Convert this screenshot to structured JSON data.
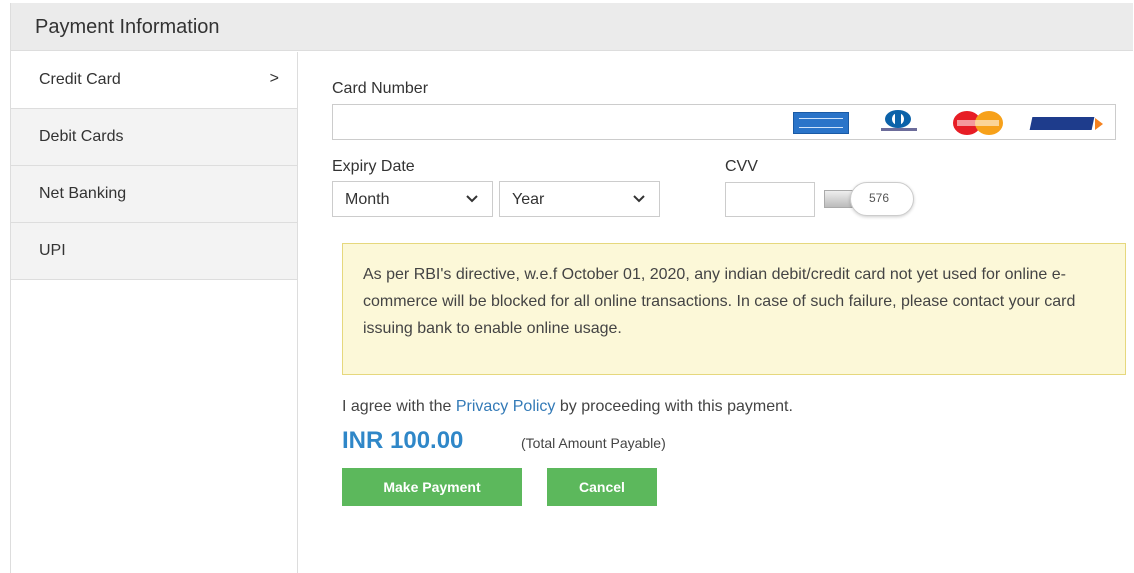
{
  "panel": {
    "title": "Payment Information"
  },
  "sidebar": {
    "items": [
      {
        "label": "Credit Card",
        "chevron": ">",
        "active": true
      },
      {
        "label": "Debit Cards"
      },
      {
        "label": "Net Banking"
      },
      {
        "label": "UPI"
      }
    ]
  },
  "form": {
    "card_number_label": "Card Number",
    "card_number_value": "",
    "card_logos": [
      "american-express",
      "diners-club",
      "mastercard",
      "rupay"
    ],
    "expiry_label": "Expiry Date",
    "month_selected": "Month",
    "year_selected": "Year",
    "cvv_label": "CVV",
    "cvv_value": "",
    "cvv_hint_number": "576"
  },
  "notice": {
    "text": "As per RBI's directive, w.e.f October 01, 2020, any indian debit/credit card not yet used for online e-commerce will be blocked for all online transactions. In case of such failure, please contact your card issuing bank to enable online usage."
  },
  "agreement": {
    "prefix": "I agree with the ",
    "link": "Privacy Policy",
    "suffix": " by proceeding with this payment."
  },
  "amount": {
    "value": "INR 100.00",
    "note": "(Total Amount Payable)"
  },
  "buttons": {
    "pay": "Make Payment",
    "cancel": "Cancel"
  },
  "colors": {
    "accent": "#2f87c8",
    "button": "#5cb85c",
    "notice_bg": "#fcf8d8",
    "link": "#337ab7"
  }
}
